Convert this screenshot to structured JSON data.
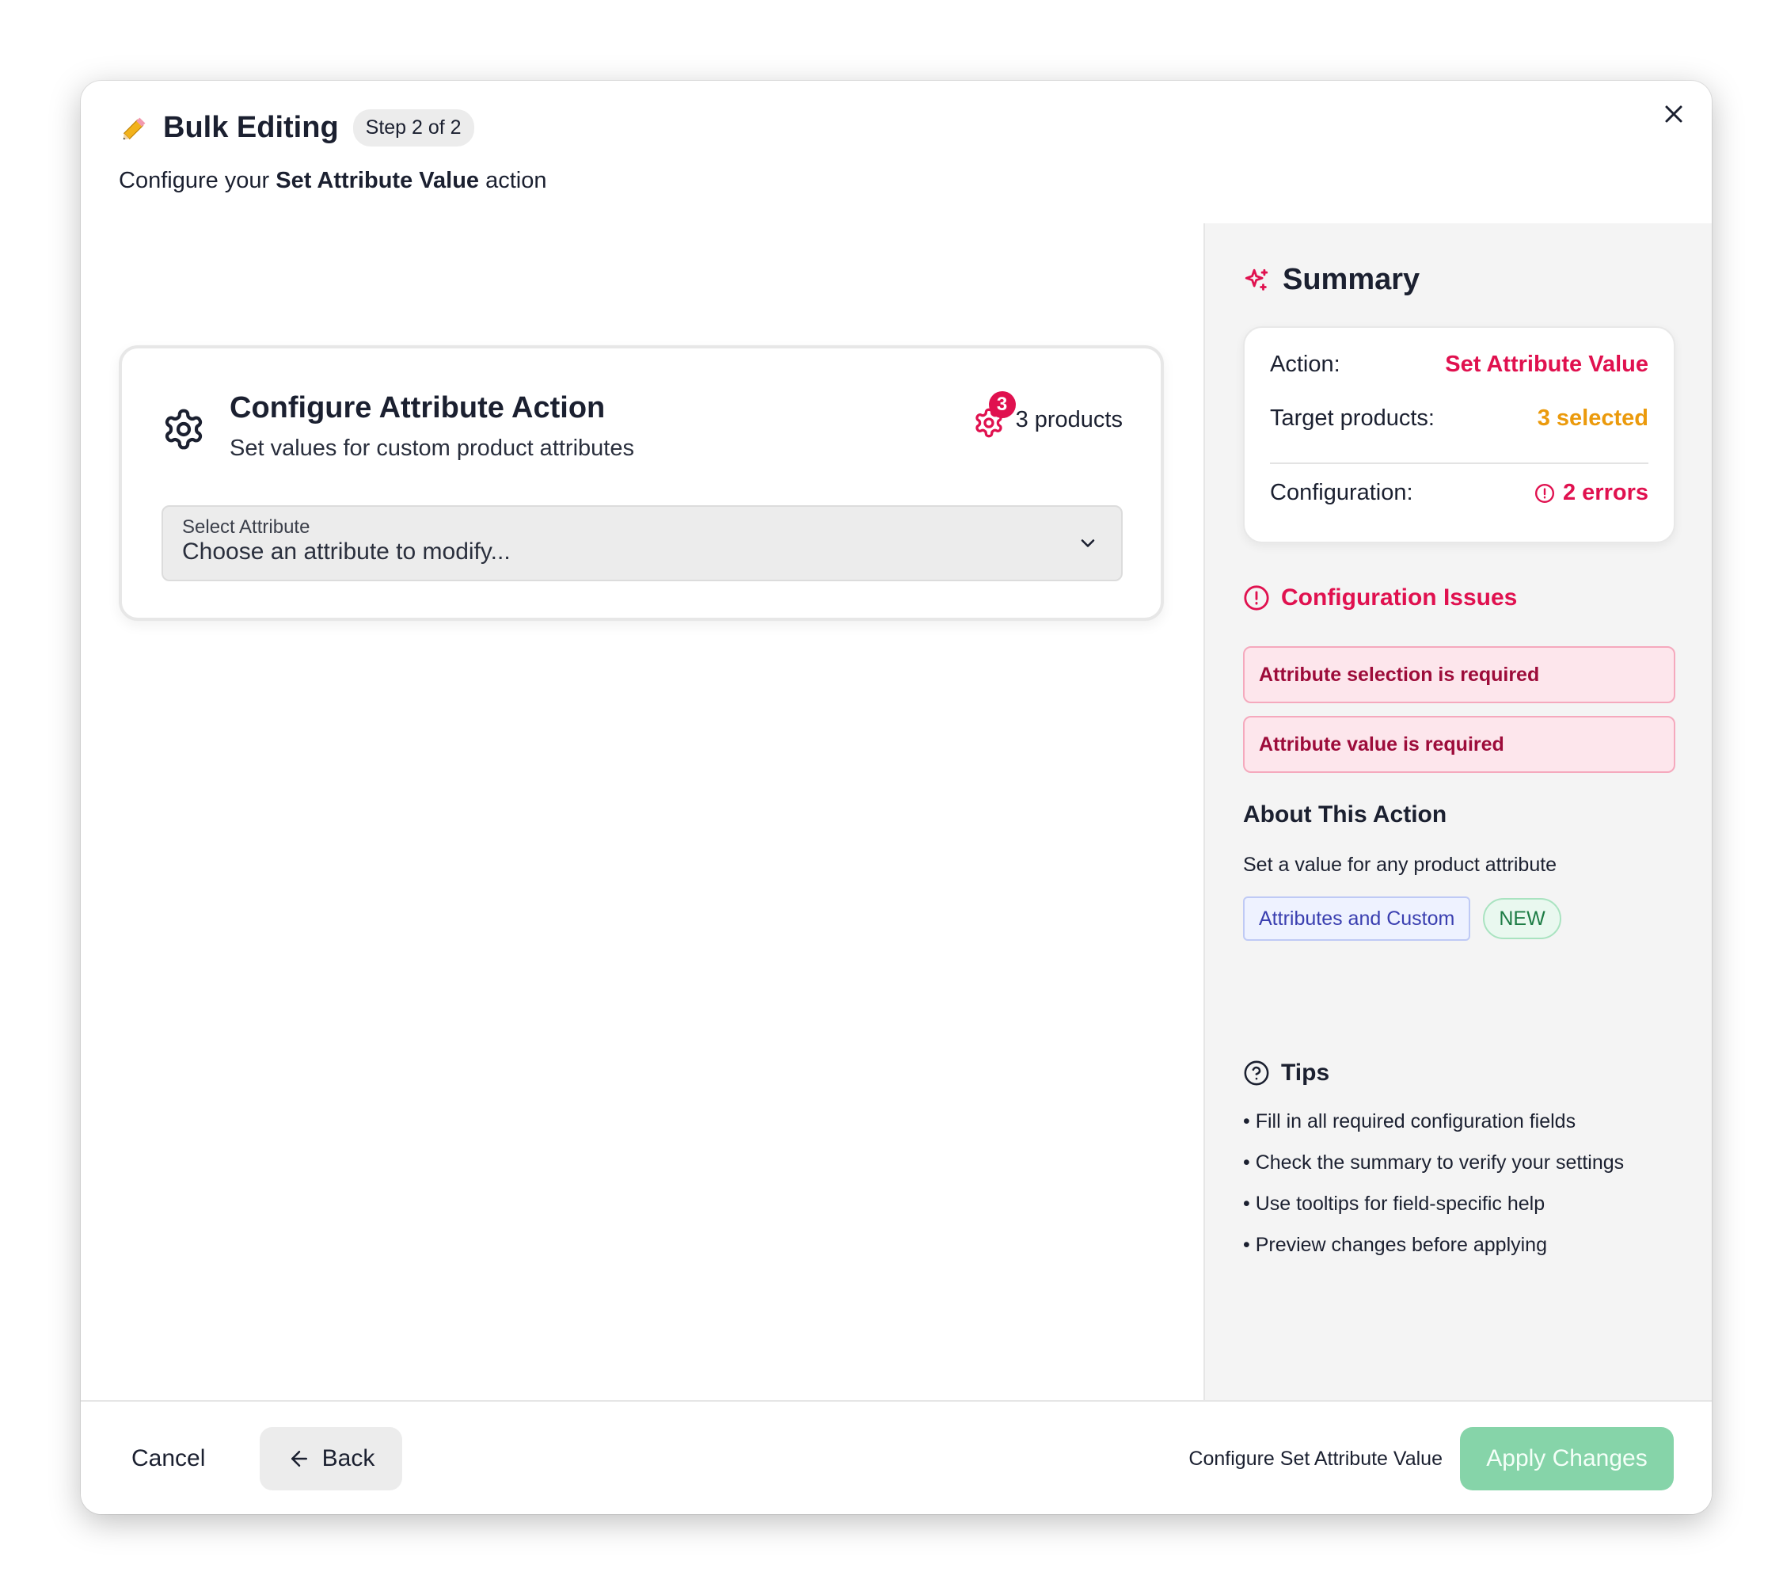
{
  "header": {
    "title": "Bulk Editing",
    "step_badge": "Step 2 of 2",
    "subtitle_prefix": "Configure your ",
    "subtitle_bold": "Set Attribute Value",
    "subtitle_suffix": " action"
  },
  "config_card": {
    "title": "Configure Attribute Action",
    "description": "Set values for custom product attributes",
    "products_count_badge": "3",
    "products_label": "3 products",
    "select": {
      "label": "Select Attribute",
      "value": "Choose an attribute to modify..."
    }
  },
  "summary": {
    "heading": "Summary",
    "rows": [
      {
        "label": "Action:",
        "value": "Set Attribute Value"
      },
      {
        "label": "Target products:",
        "value": "3 selected"
      },
      {
        "label": "Configuration:",
        "value": "2 errors"
      }
    ]
  },
  "issues": {
    "heading": "Configuration Issues",
    "items": [
      "Attribute selection is required",
      "Attribute value is required"
    ]
  },
  "about": {
    "heading": "About This Action",
    "description": "Set a value for any product attribute",
    "tag_category": "Attributes and Custom",
    "tag_new": "NEW"
  },
  "tips": {
    "heading": "Tips",
    "items": [
      "• Fill in all required configuration fields",
      "• Check the summary to verify your settings",
      "• Use tooltips for field-specific help",
      "• Preview changes before applying"
    ]
  },
  "footer": {
    "cancel_label": "Cancel",
    "back_label": "Back",
    "hint": "Configure Set Attribute Value",
    "apply_label": "Apply Changes"
  },
  "colors": {
    "accent_error": "#e0114f",
    "accent_warning": "#eb9a0c",
    "apply_disabled": "#86d4a9"
  }
}
